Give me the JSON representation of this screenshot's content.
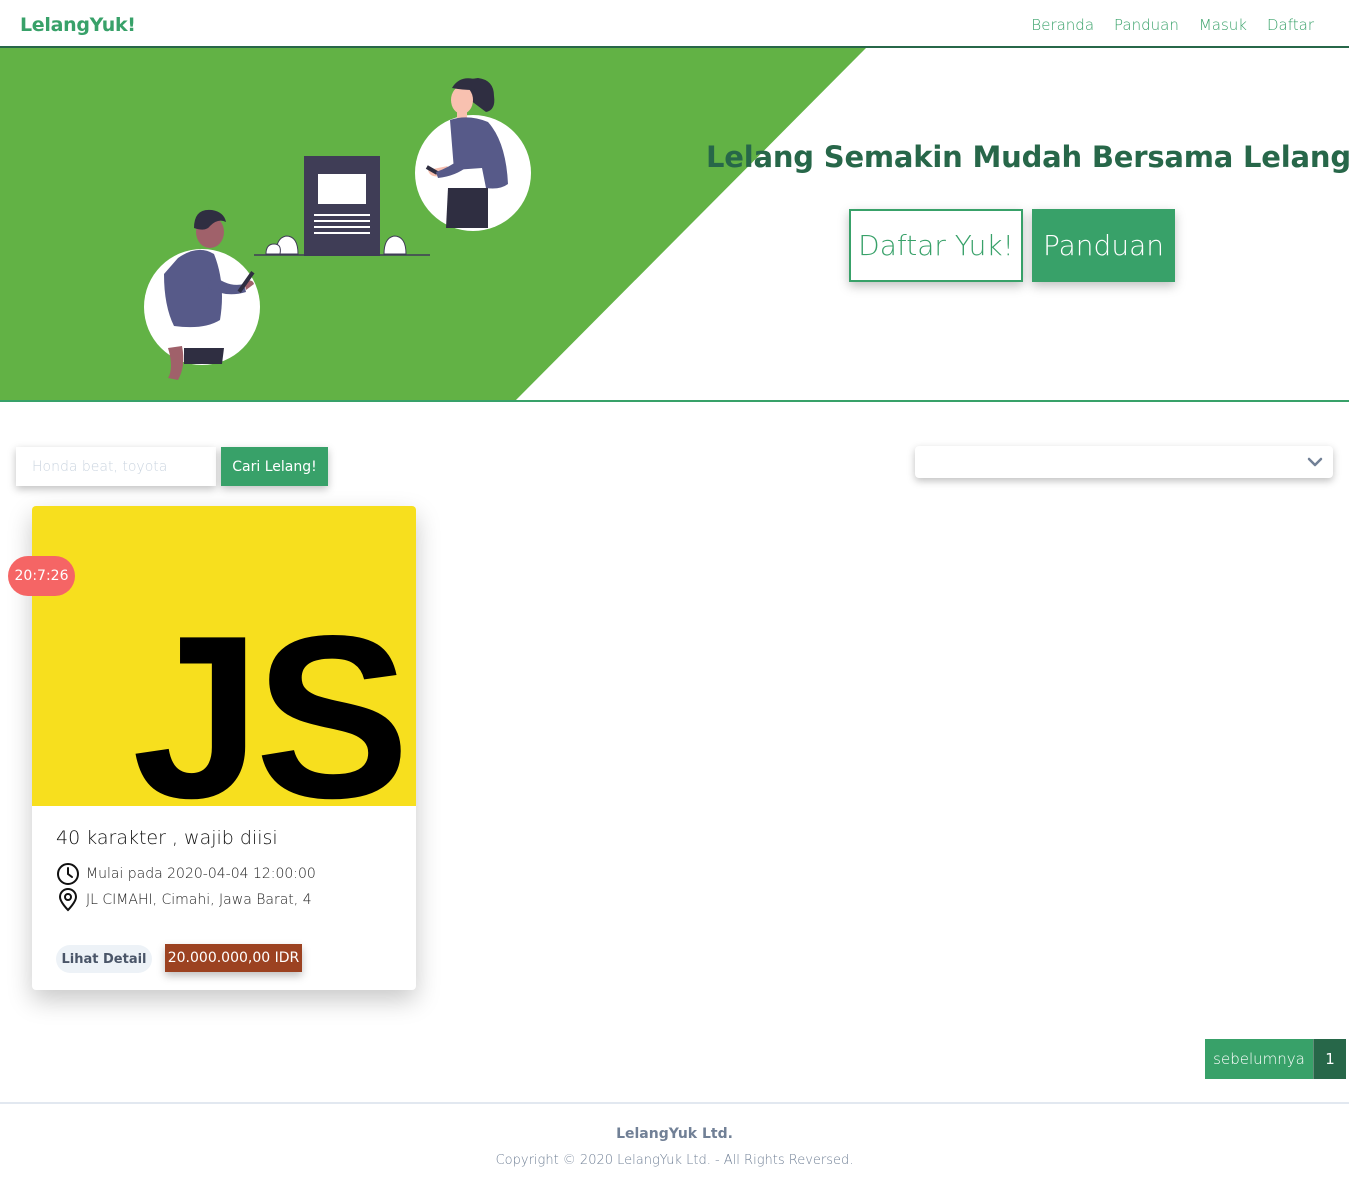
{
  "navbar": {
    "brand": "LelangYuk!",
    "links": [
      "Beranda",
      "Panduan",
      "Masuk",
      "Daftar"
    ]
  },
  "hero": {
    "title": "Lelang Semakin Mudah Bersama LelangYuk",
    "register_button": "Daftar Yuk!",
    "guide_button": "Panduan",
    "colors": {
      "green_panel": "#62b245",
      "title": "#276749",
      "accent": "#38a169"
    }
  },
  "search": {
    "placeholder": "Honda beat, toyota",
    "button": "Cari Lelang!",
    "filter_value": ""
  },
  "auctions": [
    {
      "timer": "20:7:26",
      "image_text": "JS",
      "title": "40 karakter , wajib diisi",
      "start": "Mulai pada 2020-04-04 12:00:00",
      "location": "JL CIMAHI, Cimahi, Jawa Barat, 4",
      "detail_button": "Lihat Detail",
      "price": "20.000.000,00 IDR"
    }
  ],
  "pagination": {
    "prev": "sebelumnya",
    "current": "1"
  },
  "footer": {
    "company": "LelangYuk Ltd.",
    "copyright": "Copyright © 2020 LelangYuk Ltd. - All Rights Reversed."
  }
}
